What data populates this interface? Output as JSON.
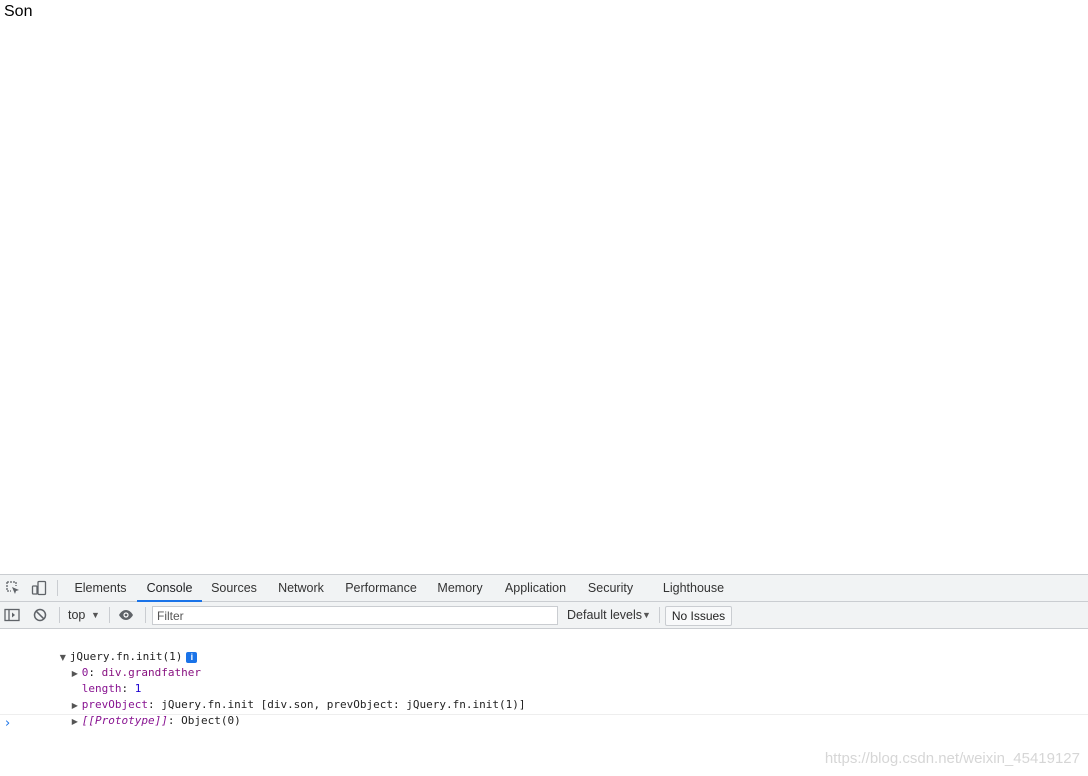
{
  "page": {
    "content_text": "Son"
  },
  "devtools": {
    "tabs": [
      {
        "label": "Elements",
        "active": false
      },
      {
        "label": "Console",
        "active": true
      },
      {
        "label": "Sources",
        "active": false
      },
      {
        "label": "Network",
        "active": false
      },
      {
        "label": "Performance",
        "active": false
      },
      {
        "label": "Memory",
        "active": false
      },
      {
        "label": "Application",
        "active": false
      },
      {
        "label": "Security",
        "active": false
      },
      {
        "label": "Lighthouse",
        "active": false
      }
    ],
    "toolbar": {
      "context": "top",
      "filter_placeholder": "Filter",
      "levels_label": "Default levels",
      "issues_label": "No Issues"
    },
    "console": {
      "root_label": "jQuery.fn.init(1)",
      "info_glyph": "i",
      "entries": [
        {
          "key": "0",
          "value": "div.grandfather"
        },
        {
          "key": "length",
          "value": "1"
        },
        {
          "key": "prevObject",
          "value": "jQuery.fn.init [div.son, prevObject: jQuery.fn.init(1)]"
        },
        {
          "key": "[[Prototype]]",
          "value": "Object(0)"
        }
      ],
      "prompt_glyph": "›"
    }
  },
  "watermark": "https://blog.csdn.net/weixin_45419127",
  "icons": {
    "inspect": "inspect-element-icon",
    "device": "device-toolbar-icon",
    "sidebar": "show-sidebar-icon",
    "clear": "clear-console-icon",
    "eye": "live-expression-icon"
  },
  "colors": {
    "accent": "#1a73e8",
    "toolbar_bg": "#f1f3f4",
    "key_purple": "#881391",
    "number_blue": "#1c00cf"
  }
}
